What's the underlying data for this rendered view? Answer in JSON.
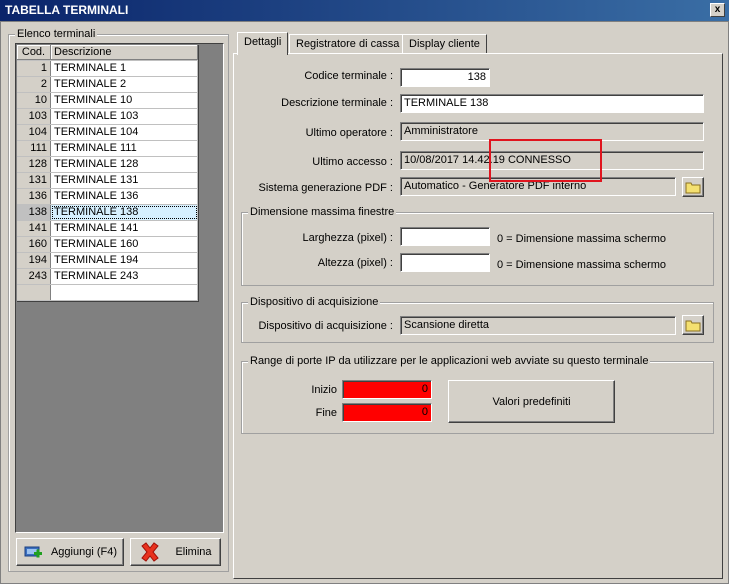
{
  "window": {
    "title": "TABELLA TERMINALI",
    "close_label": "x"
  },
  "left": {
    "group_title": "Elenco terminali",
    "columns": [
      "Cod.",
      "Descrizione"
    ],
    "rows": [
      {
        "cod": "1",
        "desc": "TERMINALE 1"
      },
      {
        "cod": "2",
        "desc": "TERMINALE 2"
      },
      {
        "cod": "10",
        "desc": "TERMINALE 10"
      },
      {
        "cod": "103",
        "desc": "TERMINALE 103"
      },
      {
        "cod": "104",
        "desc": "TERMINALE 104"
      },
      {
        "cod": "111",
        "desc": "TERMINALE 111"
      },
      {
        "cod": "128",
        "desc": "TERMINALE 128"
      },
      {
        "cod": "131",
        "desc": "TERMINALE 131"
      },
      {
        "cod": "136",
        "desc": "TERMINALE 136"
      },
      {
        "cod": "138",
        "desc": "TERMINALE 138"
      },
      {
        "cod": "141",
        "desc": "TERMINALE 141"
      },
      {
        "cod": "160",
        "desc": "TERMINALE 160"
      },
      {
        "cod": "194",
        "desc": "TERMINALE 194"
      },
      {
        "cod": "243",
        "desc": "TERMINALE 243"
      },
      {
        "cod": "",
        "desc": ""
      }
    ],
    "selected_index": 9,
    "add_label": "Aggiungi (F4)",
    "delete_label": "Elimina"
  },
  "tabs": [
    "Dettagli",
    "Registratore di cassa",
    "Display cliente"
  ],
  "details": {
    "codice_label": "Codice terminale :",
    "codice_value": "138",
    "descrizione_label": "Descrizione terminale :",
    "descrizione_value": "TERMINALE 138",
    "operatore_label": "Ultimo operatore :",
    "operatore_value": "Amministratore",
    "accesso_label": "Ultimo accesso :",
    "accesso_value": "10/08/2017  14.42.19  CONNESSO",
    "pdf_label": "Sistema generazione PDF :",
    "pdf_value": "Automatico - Generatore PDF interno",
    "dim_group": "Dimensione massima finestre",
    "larghezza_label": "Larghezza (pixel) :",
    "larghezza_value": "",
    "larghezza_hint": "0 = Dimensione massima schermo",
    "altezza_label": "Altezza (pixel) :",
    "altezza_value": "",
    "altezza_hint": "0 = Dimensione massima schermo",
    "acq_group": "Dispositivo di acquisizione",
    "acq_label": "Dispositivo di acquisizione :",
    "acq_value": "Scansione diretta",
    "range_group": "Range di porte IP da utilizzare per le applicazioni web avviate su questo terminale",
    "inizio_label": "Inizio",
    "inizio_value": "0",
    "fine_label": "Fine",
    "fine_value": "0",
    "default_button": "Valori predefiniti"
  },
  "colors": {
    "title_bar": "#0a246a",
    "highlight": "#e0141e",
    "port_field": "#ff0000"
  }
}
